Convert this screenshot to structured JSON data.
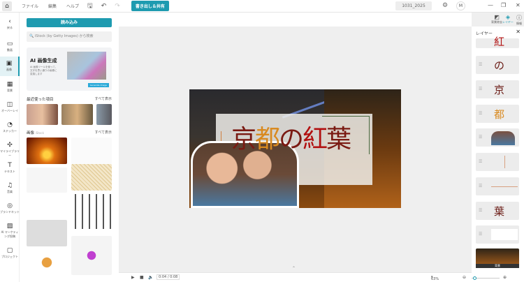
{
  "topbar": {
    "menu": [
      "ファイル",
      "編集",
      "ヘルプ"
    ],
    "export": "書き出し＆共有",
    "project": "1031_2025",
    "avatar": "M"
  },
  "rail": [
    {
      "label": "戻る",
      "icon": "‹"
    },
    {
      "label": "動画",
      "icon": "▭"
    },
    {
      "label": "画像",
      "icon": "▣"
    },
    {
      "label": "背景",
      "icon": "▦"
    },
    {
      "label": "オーバーレイ",
      "icon": "◫"
    },
    {
      "label": "ステッカー",
      "icon": "◔"
    },
    {
      "label": "マイライブラリー",
      "icon": "✣"
    },
    {
      "label": "テキスト",
      "icon": "T"
    },
    {
      "label": "音楽",
      "icon": "♫"
    },
    {
      "label": "ブランドキット",
      "icon": "◎"
    },
    {
      "label": "AI マーケティング投稿",
      "icon": "▨"
    },
    {
      "label": "プロジェクト",
      "icon": "▢"
    }
  ],
  "panel": {
    "load": "読み込み",
    "search_placeholder": "iStock (by Getty Images) から検索",
    "ai_title": "AI 画像生成",
    "ai_desc": "AI 画像ツールを使って、文字を思い通りの画像に変換します",
    "ai_button": "Generate Image",
    "recent": "最近使った項目",
    "show_all": "すべて表示",
    "images": "画像",
    "images_sub": "iStock"
  },
  "right_tools": [
    {
      "label": "背景除去",
      "icon": "◩"
    },
    {
      "label": "レイヤー",
      "icon": "◈"
    },
    {
      "label": "情報",
      "icon": "ⓘ"
    }
  ],
  "canvas": {
    "title": [
      "京",
      "都",
      "の",
      "紅",
      "葉"
    ]
  },
  "layers": {
    "title": "レイヤー",
    "items": [
      "紅",
      "の",
      "京",
      "都",
      "",
      "",
      "",
      "葉",
      "",
      ""
    ],
    "bg_label": "背景"
  },
  "bottom": {
    "time": "0:04 / 0:08",
    "zoom": "63%"
  }
}
